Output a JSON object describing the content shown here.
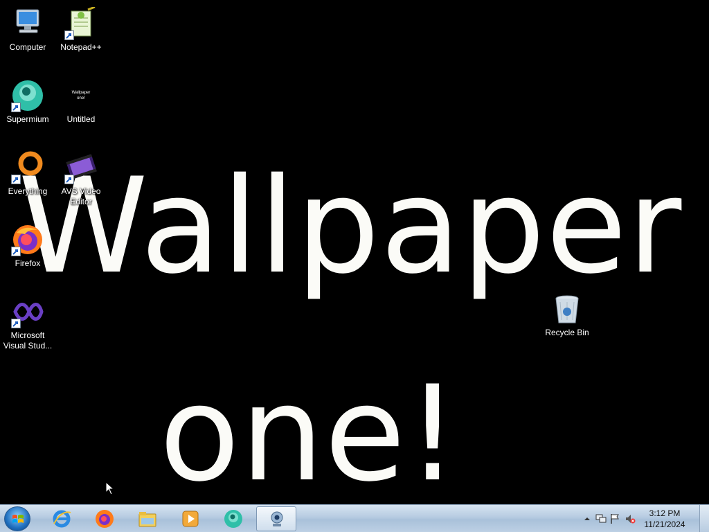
{
  "wallpaper": {
    "line1": "Wallpaper",
    "line2": "one!"
  },
  "desktop_icons": [
    {
      "label": "Computer",
      "icon": "computer-icon"
    },
    {
      "label": "Notepad++",
      "icon": "notepadpp-icon"
    },
    {
      "label": "Supermium",
      "icon": "supermium-icon"
    },
    {
      "label": "Untitled",
      "icon": "wallpaper-thumbnail-icon",
      "thumbnail_text": "Wallpaper one!"
    },
    {
      "label": "Everything",
      "icon": "everything-search-icon"
    },
    {
      "label": "AVS Video Editor",
      "icon": "video-editor-icon"
    },
    {
      "label": "Firefox",
      "icon": "firefox-icon"
    },
    {
      "label": "Microsoft Visual Stud...",
      "icon": "visual-studio-icon"
    },
    {
      "label": "Recycle Bin",
      "icon": "recycle-bin-icon"
    }
  ],
  "taskbar": {
    "start_icon": "windows-start-icon",
    "pinned": [
      {
        "icon": "internet-explorer-icon"
      },
      {
        "icon": "firefox-icon"
      },
      {
        "icon": "file-explorer-icon"
      },
      {
        "icon": "media-player-icon"
      },
      {
        "icon": "supermium-icon"
      },
      {
        "icon": "webcam-app-icon",
        "active": true
      }
    ],
    "tray": {
      "icons": [
        "show-hidden-icons-arrow",
        "network-icon",
        "action-center-flag-icon",
        "volume-muted-icon"
      ],
      "time": "3:12 PM",
      "date": "11/21/2024"
    }
  },
  "colors": {
    "desktop_background": "#000000",
    "wallpaper_text": "#fbfbf7",
    "taskbar": "#b6cbe1"
  }
}
